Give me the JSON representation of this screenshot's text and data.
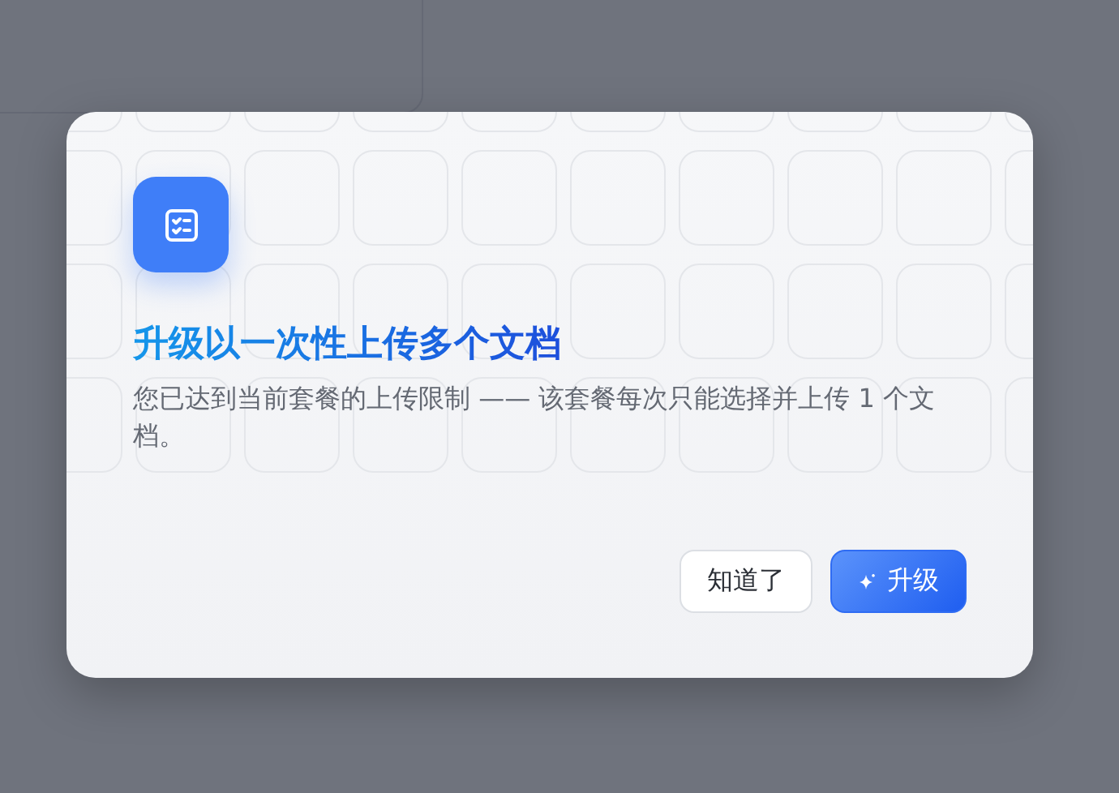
{
  "dialog": {
    "title": "升级以一次性上传多个文档",
    "message": "您已达到当前套餐的上传限制 —— 该套餐每次只能选择并上传 1 个文档。",
    "buttons": [
      {
        "kind": "secondary",
        "label": "知道了"
      },
      {
        "kind": "primary",
        "label": "升级"
      }
    ]
  }
}
